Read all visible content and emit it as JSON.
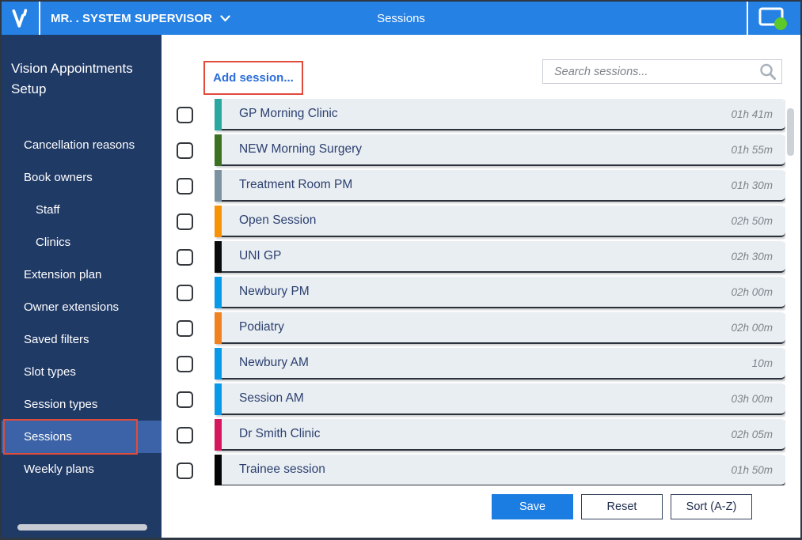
{
  "topbar": {
    "user_menu": "MR. . SYSTEM SUPERVISOR",
    "title": "Sessions"
  },
  "sidebar": {
    "title": "Vision Appointments Setup",
    "items": [
      {
        "label": "Cancellation reasons",
        "indent": 1,
        "selected": false
      },
      {
        "label": "Book owners",
        "indent": 1,
        "selected": false
      },
      {
        "label": "Staff",
        "indent": 2,
        "selected": false
      },
      {
        "label": "Clinics",
        "indent": 2,
        "selected": false
      },
      {
        "label": "Extension plan",
        "indent": 1,
        "selected": false
      },
      {
        "label": "Owner extensions",
        "indent": 1,
        "selected": false
      },
      {
        "label": "Saved filters",
        "indent": 1,
        "selected": false
      },
      {
        "label": "Slot types",
        "indent": 1,
        "selected": false
      },
      {
        "label": "Session types",
        "indent": 1,
        "selected": false
      },
      {
        "label": "Sessions",
        "indent": 1,
        "selected": true,
        "annotated": true
      },
      {
        "label": "Weekly plans",
        "indent": 1,
        "selected": false
      }
    ]
  },
  "main": {
    "add_button": "Add session...",
    "search_placeholder": "Search sessions...",
    "sessions": [
      {
        "name": "GP Morning Clinic",
        "duration": "01h 41m",
        "color": "#2aa79f"
      },
      {
        "name": "NEW Morning Surgery",
        "duration": "01h 55m",
        "color": "#3c7122"
      },
      {
        "name": "Treatment Room PM",
        "duration": "01h 30m",
        "color": "#7e93a2"
      },
      {
        "name": "Open Session",
        "duration": "02h 50m",
        "color": "#f89305"
      },
      {
        "name": "UNI GP",
        "duration": "02h 30m",
        "color": "#0b0b0b"
      },
      {
        "name": "Newbury PM",
        "duration": "02h 00m",
        "color": "#0899e9"
      },
      {
        "name": "Podiatry",
        "duration": "02h 00m",
        "color": "#f0821f"
      },
      {
        "name": "Newbury AM",
        "duration": "10m",
        "color": "#0899e9"
      },
      {
        "name": "Session AM",
        "duration": "03h 00m",
        "color": "#0899e9"
      },
      {
        "name": "Dr Smith Clinic",
        "duration": "02h 05m",
        "color": "#d6175f"
      },
      {
        "name": "Trainee session",
        "duration": "01h 50m",
        "color": "#050505"
      }
    ],
    "actions": {
      "save": "Save",
      "reset": "Reset",
      "sort": "Sort (A-Z)"
    }
  },
  "colors": {
    "topbar": "#2581e4",
    "sidebar": "#203a66",
    "selected_item": "#3c63a7",
    "annotation_red": "#e14b3b",
    "save_blue": "#1b7ce2",
    "status_green": "#5dc829"
  }
}
